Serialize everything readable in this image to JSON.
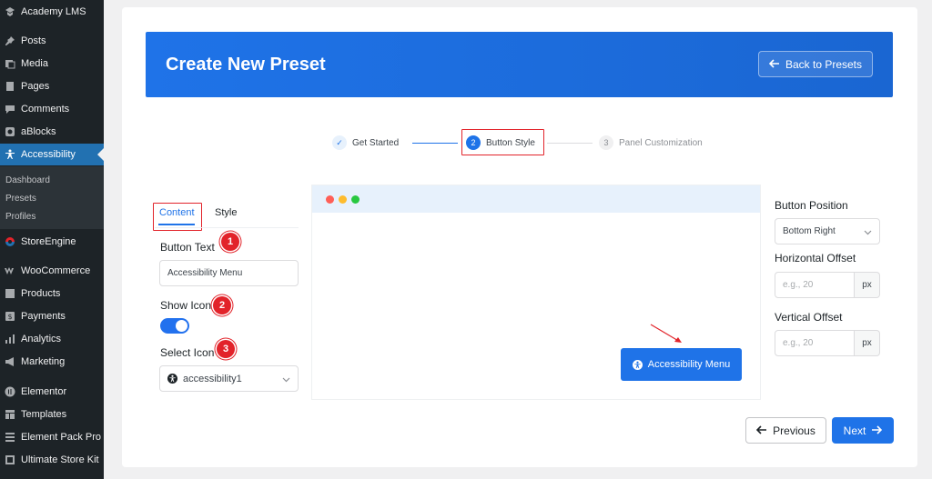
{
  "sidebar": {
    "items": [
      {
        "label": "Academy LMS",
        "icon": "academy-icon"
      },
      {
        "label": "Posts",
        "icon": "pin-icon"
      },
      {
        "label": "Media",
        "icon": "media-icon"
      },
      {
        "label": "Pages",
        "icon": "pages-icon"
      },
      {
        "label": "Comments",
        "icon": "comment-icon"
      },
      {
        "label": "aBlocks",
        "icon": "ablocks-icon"
      },
      {
        "label": "Accessibility",
        "icon": "accessibility-icon",
        "active": true
      },
      {
        "label": "StoreEngine",
        "icon": "storeengine-icon"
      },
      {
        "label": "WooCommerce",
        "icon": "woocommerce-icon"
      },
      {
        "label": "Products",
        "icon": "products-icon"
      },
      {
        "label": "Payments",
        "icon": "payments-icon"
      },
      {
        "label": "Analytics",
        "icon": "analytics-icon"
      },
      {
        "label": "Marketing",
        "icon": "marketing-icon"
      },
      {
        "label": "Elementor",
        "icon": "elementor-icon"
      },
      {
        "label": "Templates",
        "icon": "templates-icon"
      },
      {
        "label": "Element Pack Pro",
        "icon": "element-pack-icon"
      },
      {
        "label": "Ultimate Store Kit",
        "icon": "store-kit-icon"
      }
    ],
    "submenu": [
      "Dashboard",
      "Presets",
      "Profiles"
    ]
  },
  "header": {
    "title": "Create New Preset",
    "back_label": "Back to Presets"
  },
  "stepper": {
    "steps": [
      {
        "num": "✓",
        "label": "Get Started",
        "state": "done"
      },
      {
        "num": "2",
        "label": "Button Style",
        "state": "active"
      },
      {
        "num": "3",
        "label": "Panel Customization",
        "state": "pending"
      }
    ]
  },
  "config": {
    "tabs": [
      "Content",
      "Style"
    ],
    "button_text_label": "Button Text",
    "button_text_value": "Accessibility Menu",
    "show_icon_label": "Show Icon",
    "show_icon_on": true,
    "select_icon_label": "Select Icon",
    "select_icon_value": "accessibility1",
    "badges": [
      "1",
      "2",
      "3"
    ]
  },
  "preview": {
    "button_label": "Accessibility Menu"
  },
  "position": {
    "button_position_label": "Button Position",
    "button_position_value": "Bottom Right",
    "horizontal_label": "Horizontal Offset",
    "horizontal_placeholder": "e.g., 20",
    "vertical_label": "Vertical Offset",
    "vertical_placeholder": "e.g., 20",
    "unit": "px"
  },
  "footer": {
    "previous_label": "Previous",
    "next_label": "Next"
  },
  "colors": {
    "primary": "#1f73e8",
    "highlight": "#e2232a",
    "sidebar_bg": "#1d2327"
  }
}
